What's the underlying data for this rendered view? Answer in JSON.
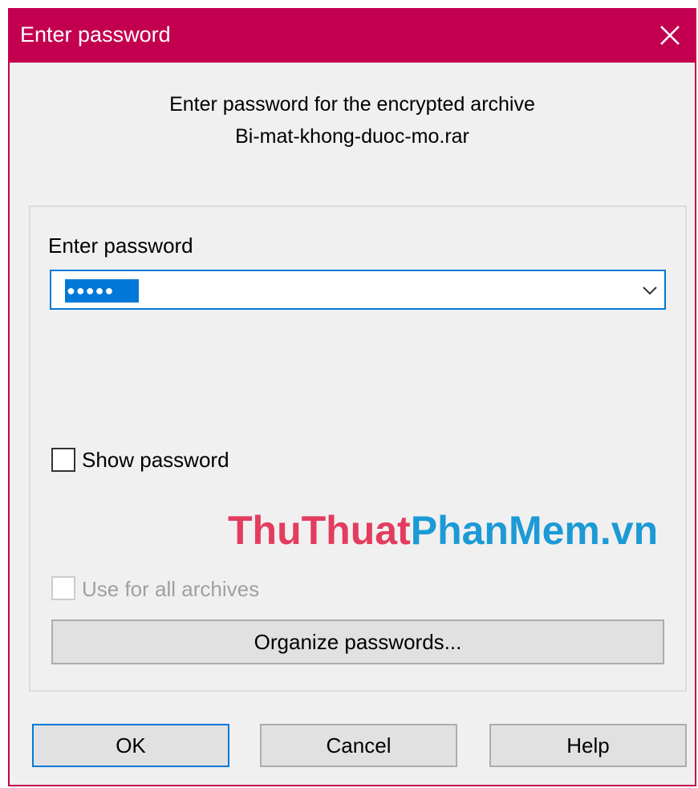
{
  "window": {
    "title": "Enter password",
    "accent_color": "#c3004f",
    "close_icon": "close-icon"
  },
  "header": {
    "line1": "Enter password for the encrypted archive",
    "line2": "Bi-mat-khong-duoc-mo.rar"
  },
  "password": {
    "label": "Enter password",
    "value": "●●●●●",
    "dropdown_icon": "chevron-down-icon"
  },
  "options": {
    "show_password": {
      "label": "Show password",
      "checked": false
    },
    "use_for_all": {
      "label": "Use for all archives",
      "checked": false,
      "disabled": true
    }
  },
  "watermark": {
    "part1": "ThuThuat",
    "part2": "PhanMem.vn"
  },
  "buttons": {
    "organize": "Organize passwords...",
    "ok": "OK",
    "cancel": "Cancel",
    "help": "Help"
  }
}
